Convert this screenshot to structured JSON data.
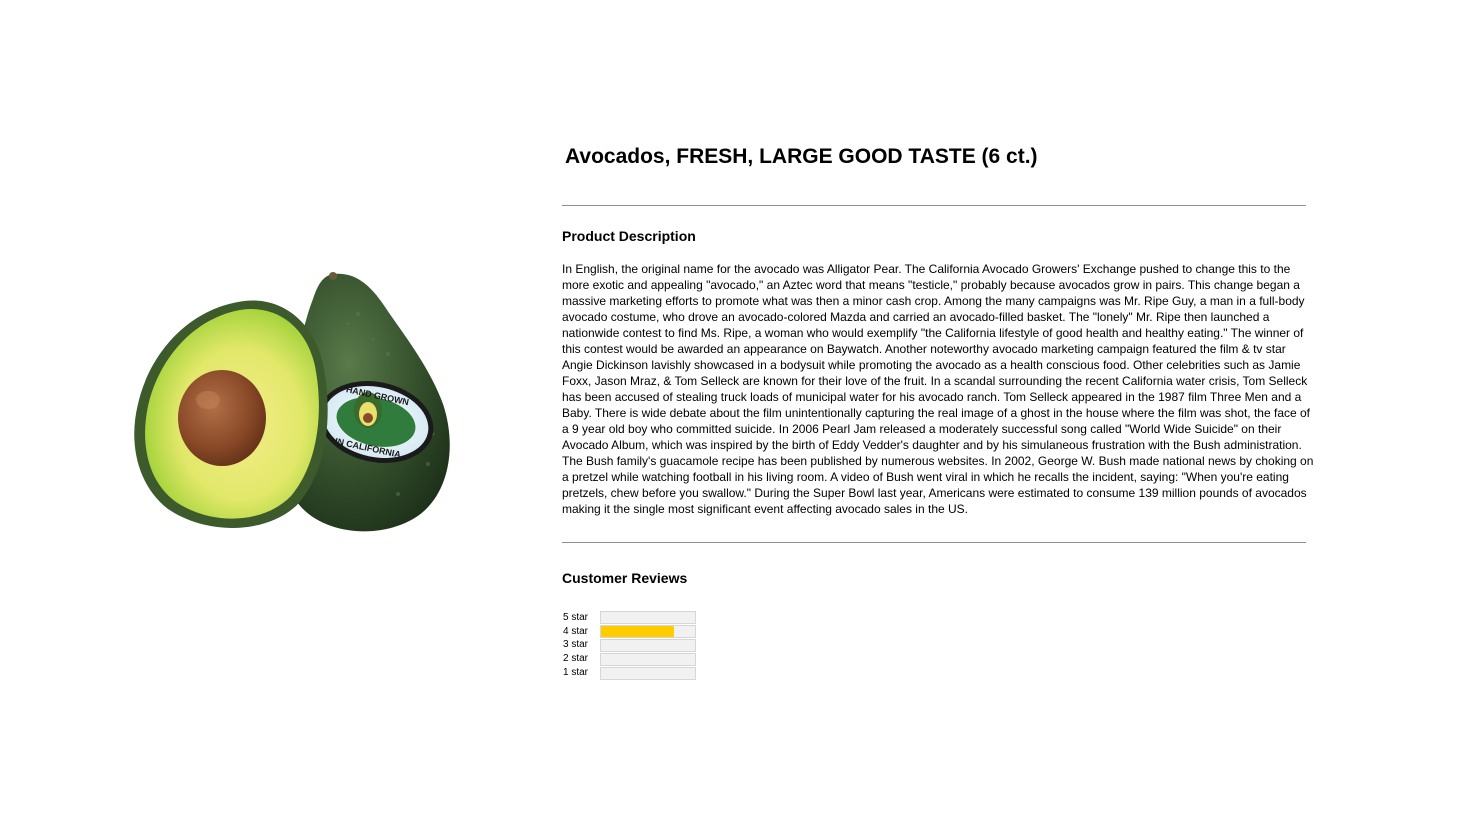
{
  "product": {
    "title": "Avocados, FRESH, LARGE GOOD TASTE (6 ct.)",
    "image_alt": "avocado-image",
    "sticker_text_top": "HAND GROWN",
    "sticker_text_bottom": "IN CALIFORNIA"
  },
  "description": {
    "heading": "Product Description",
    "text": "In English, the original name for the avocado was Alligator Pear. The California Avocado Growers' Exchange pushed to change this to the more exotic and appealing \"avocado,\" an Aztec word that means \"testicle,\" probably because avocados grow in pairs. This change began a massive marketing efforts to promote what was then a minor cash crop. Among the many campaigns was Mr. Ripe Guy, a man in a full-body avocado costume, who drove an avocado-colored Mazda and carried an avocado-filled basket. The \"lonely\" Mr. Ripe then launched a nationwide contest to find Ms. Ripe, a woman who would exemplify \"the California lifestyle of good health and healthy eating.\" The winner of this contest would be awarded an appearance on Baywatch. Another noteworthy avocado marketing campaign featured the film & tv star Angie Dickinson lavishly showcased in a bodysuit while promoting the avocado as a health conscious food. Other celebrities such as Jamie Foxx, Jason Mraz, & Tom Selleck are known for their love of the fruit. In a scandal surrounding the recent California water crisis, Tom Selleck has been accused of stealing truck loads of municipal water for his avocado ranch. Tom Selleck appeared in the 1987 film Three Men and a Baby. There is wide debate about the film unintentionally capturing the real image of a ghost in the house where the film was shot, the face of a 9 year old boy who committed suicide. In 2006 Pearl Jam released a moderately successful song called \"World Wide Suicide\" on their Avocado Album, which was  inspired by the birth of Eddy Vedder's daughter and by his simulaneous frustration with the Bush administration. The Bush family's guacamole recipe has been published by numerous websites. In 2002, George W. Bush made national news by choking on a pretzel while watching football in his living room. A video of Bush went viral in which he recalls the incident, saying: \"When you're eating pretzels, chew before you swallow.\" During the Super Bowl last year, Americans were estimated to consume 139 million pounds of avocados making it the single most significant event affecting avocado sales in the US."
  },
  "reviews": {
    "heading": "Customer Reviews",
    "fill_color": "#ffcc00",
    "rows": [
      {
        "label": "5 star",
        "fraction": 0
      },
      {
        "label": "4 star",
        "fraction": 0.78
      },
      {
        "label": "3 star",
        "fraction": 0
      },
      {
        "label": "2 star",
        "fraction": 0
      },
      {
        "label": "1 star",
        "fraction": 0
      }
    ]
  }
}
